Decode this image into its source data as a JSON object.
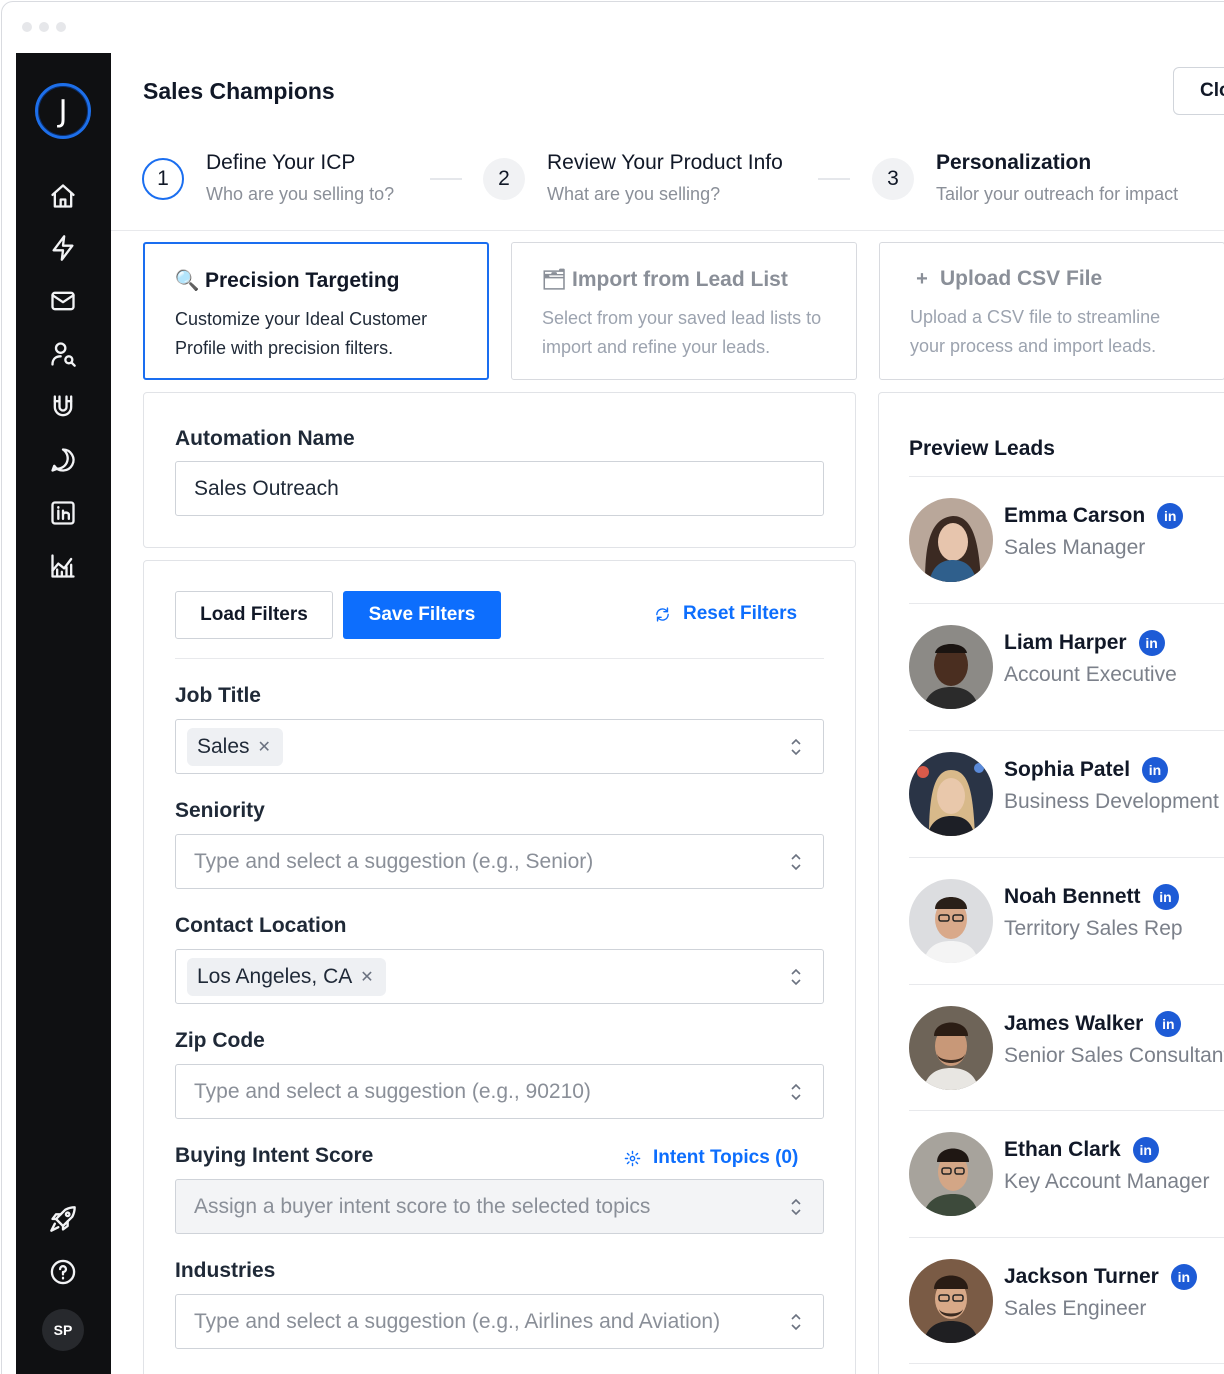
{
  "header": {
    "title": "Sales Champions",
    "close_label": "Clo"
  },
  "steps": [
    {
      "number": "1",
      "title": "Define Your ICP",
      "subtitle": "Who are you selling to?"
    },
    {
      "number": "2",
      "title": "Review Your Product Info",
      "subtitle": "What are you selling?"
    },
    {
      "number": "3",
      "title": "Personalization",
      "subtitle": "Tailor your outreach for impact"
    }
  ],
  "options": [
    {
      "icon": "🔍",
      "title": "Precision Targeting",
      "desc": "Customize your Ideal Customer Profile with precision filters."
    },
    {
      "icon": "🗂",
      "title": "Import from Lead List",
      "desc": "Select from your saved lead lists to import and refine your leads."
    },
    {
      "icon": "+",
      "title": "Upload CSV File",
      "desc": "Upload a CSV file to streamline your process and import leads."
    }
  ],
  "automation": {
    "label": "Automation Name",
    "value": "Sales Outreach"
  },
  "filters": {
    "load_label": "Load Filters",
    "save_label": "Save Filters",
    "reset_label": "Reset Filters",
    "job_title": {
      "label": "Job Title",
      "chip": "Sales"
    },
    "seniority": {
      "label": "Seniority",
      "placeholder": "Type and select a suggestion (e.g., Senior)"
    },
    "location": {
      "label": "Contact Location",
      "chip": "Los Angeles, CA"
    },
    "zip": {
      "label": "Zip Code",
      "placeholder": "Type and select a suggestion (e.g., 90210)"
    },
    "intent": {
      "label": "Buying Intent Score",
      "topics_label": "Intent Topics (0)",
      "placeholder": "Assign a buyer intent score to the selected topics"
    },
    "industries": {
      "label": "Industries",
      "placeholder": "Type and select a suggestion (e.g., Airlines and Aviation)"
    }
  },
  "preview": {
    "title": "Preview Leads",
    "linkedin_badge": "in",
    "leads": [
      {
        "name": "Emma Carson",
        "role": "Sales Manager"
      },
      {
        "name": "Liam Harper",
        "role": "Account Executive"
      },
      {
        "name": "Sophia Patel",
        "role": "Business Development"
      },
      {
        "name": "Noah Bennett",
        "role": "Territory Sales Rep"
      },
      {
        "name": "James Walker",
        "role": "Senior Sales Consultant"
      },
      {
        "name": "Ethan Clark",
        "role": "Key Account Manager"
      },
      {
        "name": "Jackson Turner",
        "role": "Sales Engineer"
      }
    ]
  },
  "sidebar": {
    "logo_letter": "J",
    "avatar_initials": "SP",
    "icons": [
      "home-icon",
      "lightning-icon",
      "mail-icon",
      "user-search-icon",
      "magnet-icon",
      "chat-icon",
      "linkedin-icon",
      "chart-icon",
      "rocket-icon",
      "help-icon"
    ]
  },
  "colors": {
    "accent": "#0d6efd",
    "sidebar_bg": "#0f1012",
    "linkedin": "#1d5bd6"
  }
}
